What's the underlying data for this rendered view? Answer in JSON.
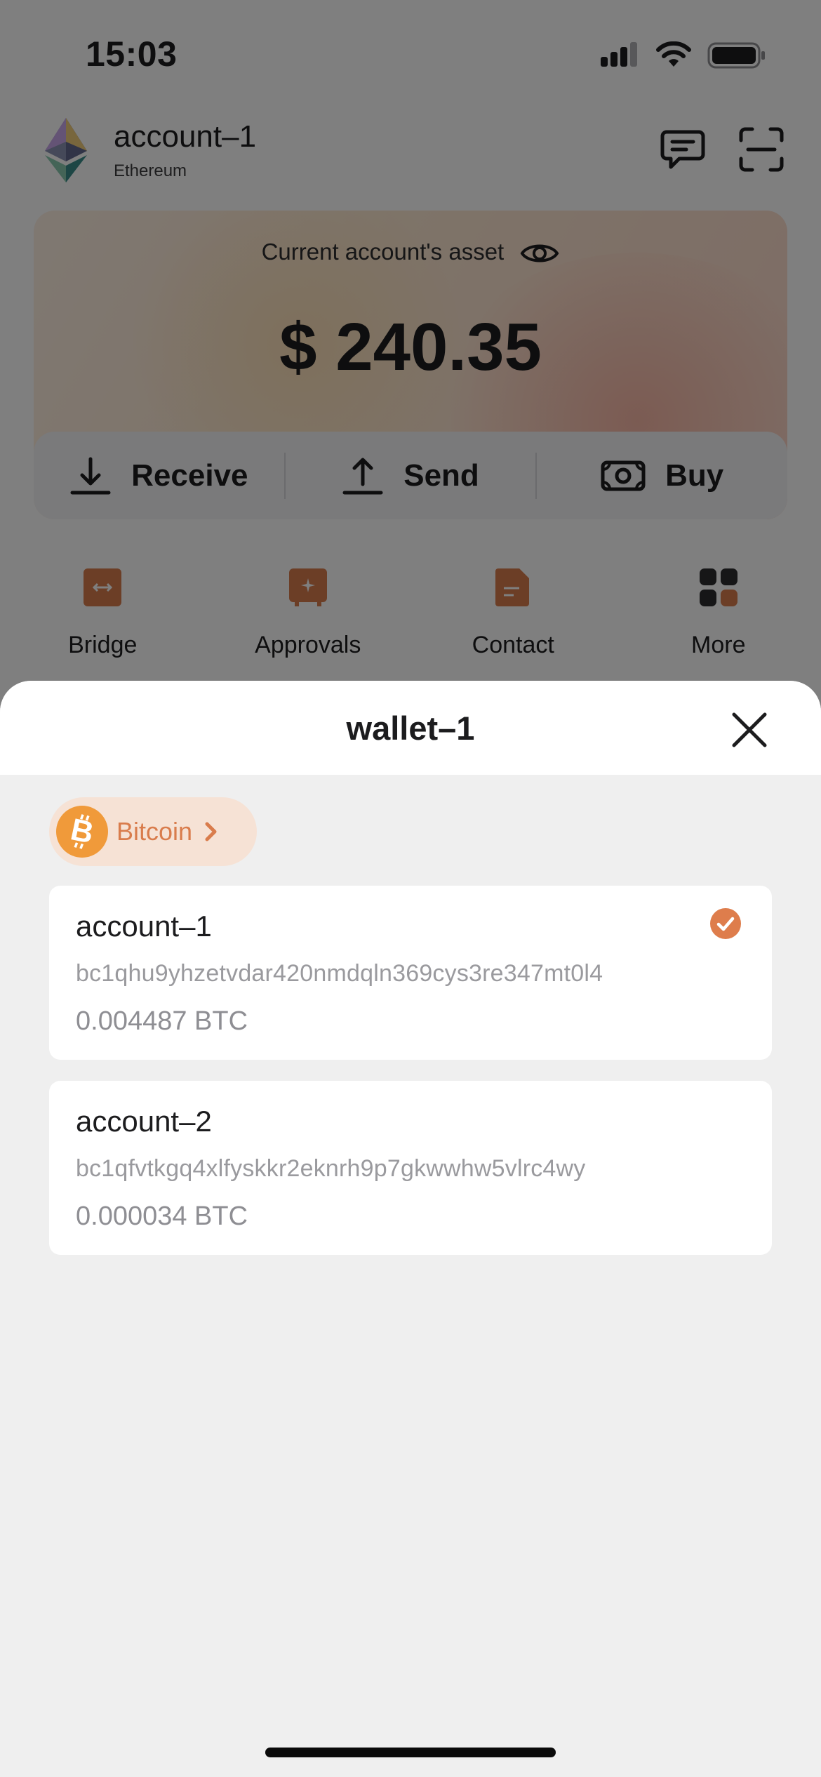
{
  "status_bar": {
    "time": "15:03"
  },
  "header": {
    "account_name": "account–1",
    "chain": "Ethereum"
  },
  "asset": {
    "label": "Current account's asset",
    "value": "$ 240.35"
  },
  "actions": {
    "receive": "Receive",
    "send": "Send",
    "buy": "Buy"
  },
  "quick_actions": [
    {
      "label": "Bridge"
    },
    {
      "label": "Approvals"
    },
    {
      "label": "Contact"
    },
    {
      "label": "More"
    }
  ],
  "sheet": {
    "title": "wallet–1",
    "chain_selector": {
      "label": "Bitcoin"
    },
    "accounts": [
      {
        "name": "account–1",
        "address": "bc1qhu9yhzetvdar420nmdqln369cys3re347mt0l4",
        "balance": "0.004487 BTC",
        "selected": true
      },
      {
        "name": "account–2",
        "address": "bc1qfvtkgq4xlfyskkr2eknrh9p7gkwwhw5vlrc4wy",
        "balance": "0.000034 BTC",
        "selected": false
      }
    ]
  },
  "colors": {
    "accent": "#d97c4c",
    "bitcoin": "#f09a3a",
    "check": "#de7d4c",
    "sheet_bg": "#efefef"
  },
  "icons": {
    "status": [
      "cellular-signal-icon",
      "wifi-icon",
      "battery-icon"
    ],
    "header": [
      "ethereum-logo-icon",
      "message-icon",
      "scan-icon"
    ],
    "asset": [
      "eye-icon"
    ],
    "actions": [
      "download-icon",
      "upload-icon",
      "cash-icon"
    ],
    "quick": [
      "bridge-icon",
      "approvals-icon",
      "contact-icon",
      "more-grid-icon"
    ],
    "sheet": [
      "close-icon",
      "bitcoin-icon",
      "chevron-right-icon",
      "checkmark-icon"
    ]
  }
}
